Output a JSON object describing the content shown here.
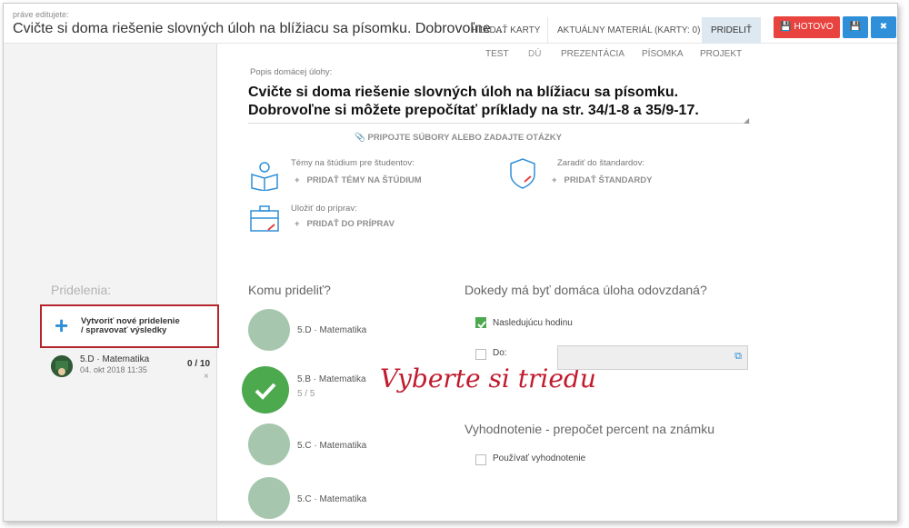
{
  "header": {
    "editing_label": "práve editujete:",
    "title": "Cvičte si doma riešenie slovných úloh na blížiacu sa písomku. Dobrovoľne ...",
    "tab_search": "HĽADAŤ KARTY",
    "tab_current": "AKTUÁLNY MATERIÁL (KARTY: 0)",
    "tab_assign": "PRIDELIŤ",
    "done_label": "HOTOVO",
    "save_icon": "save-icon",
    "close_icon": "close-icon"
  },
  "sidebar": {
    "title": "Pridelenia:",
    "new_assign_line1": "Vytvoriť nové pridelenie",
    "new_assign_line2": "/ spravovať výsledky",
    "item": {
      "name": "5.D · Matematika",
      "date": "04. okt 2018 11:35",
      "count": "0 / 10",
      "remove": "×"
    }
  },
  "subtabs": [
    "TEST",
    "DÚ",
    "PREZENTÁCIA",
    "PÍSOMKA",
    "PROJEKT"
  ],
  "homework": {
    "label": "Popis domácej úlohy:",
    "text_line1": "Cvičte si doma riešenie slovných úloh na blížiacu sa písomku.",
    "text_line2": "Dobrovoľne si môžete prepočítať príklady na str. 34/1-8 a 35/9-17.",
    "attach": "PRIPOJTE SÚBORY ALEBO ZADAJTE OTÁZKY"
  },
  "blocks": {
    "topics_label": "Témy na štúdium pre študentov:",
    "topics_action": "PRIDAŤ TÉMY NA ŠTÚDIUM",
    "standards_label": "Zaradiť do štandardov:",
    "standards_action": "PRIDAŤ ŠTANDARDY",
    "prep_label": "Uložiť do príprav:",
    "prep_action": "PRIDAŤ DO PRÍPRAV"
  },
  "assign": {
    "title": "Komu prideliť?",
    "classes": [
      {
        "name": "5.D · Matematika",
        "sub": ""
      },
      {
        "name": "5.B · Matematika",
        "sub": "5 / 5"
      },
      {
        "name": "5.C · Matematika",
        "sub": ""
      },
      {
        "name": "5.C · Matematika",
        "sub": ""
      }
    ]
  },
  "deadline": {
    "title": "Dokedy má byť domáca úloha odovzdaná?",
    "next_lesson": "Nasledujúcu hodinu",
    "until": "Do:"
  },
  "evaluation": {
    "title": "Vyhodnotenie - prepočet percent na známku",
    "use_eval": "Používať vyhodnotenie"
  },
  "annotation": "Vyberte si triedu",
  "colors": {
    "accent": "#2f8fd8",
    "done": "#e8433f",
    "selected": "#4ca94e",
    "highlight": "#b5252c"
  }
}
